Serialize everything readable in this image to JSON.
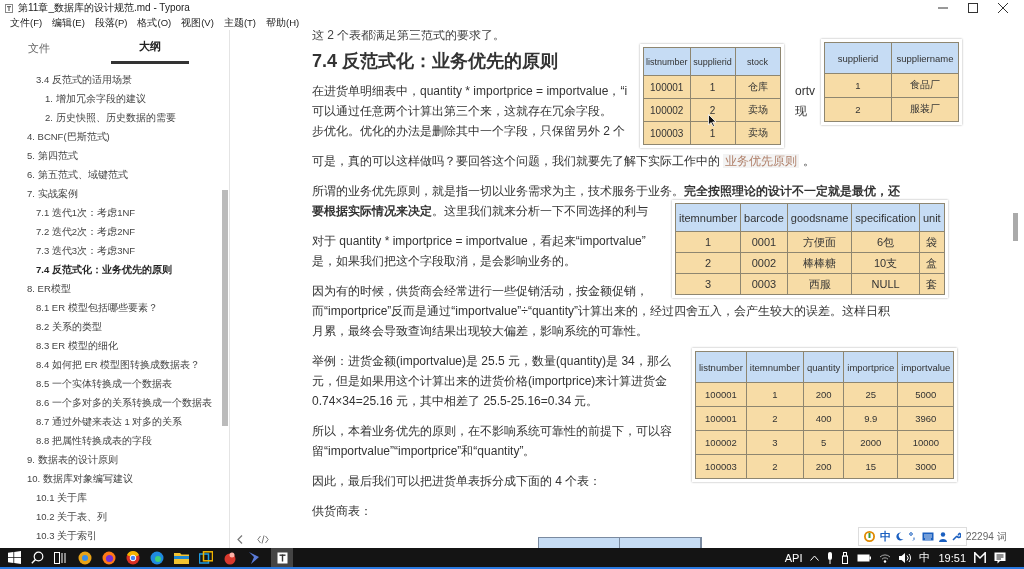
{
  "window": {
    "title": "第11章_数据库的设计规范.md - Typora"
  },
  "menu": [
    "文件(F)",
    "编辑(E)",
    "段落(P)",
    "格式(O)",
    "视图(V)",
    "主题(T)",
    "帮助(H)"
  ],
  "sidebar": {
    "tabs": [
      {
        "label": "文件",
        "selected": false
      },
      {
        "label": "大纲",
        "selected": true
      }
    ],
    "outline_continued": [
      {
        "text": "3.4 反范式的适用场景",
        "selected": false,
        "children": [
          {
            "text": "1. 增加冗余字段的建议",
            "selected": false
          },
          {
            "text": "2. 历史快照、历史数据的需要",
            "selected": false
          }
        ]
      }
    ],
    "outline": [
      {
        "text": "4. BCNF(巴斯范式)",
        "selected": false
      },
      {
        "text": "5. 第四范式",
        "selected": false
      },
      {
        "text": "6. 第五范式、域键范式",
        "selected": false
      },
      {
        "text": "7. 实战案例",
        "selected": false,
        "children": [
          {
            "text": "7.1 迭代1次：考虑1NF",
            "selected": false
          },
          {
            "text": "7.2 迭代2次：考虑2NF",
            "selected": false
          },
          {
            "text": "7.3 迭代3次：考虑3NF",
            "selected": false
          },
          {
            "text": "7.4 反范式化：业务优先的原则",
            "selected": true
          }
        ]
      },
      {
        "text": "8. ER模型",
        "selected": false,
        "children": [
          {
            "text": "8.1 ER 模型包括哪些要素？",
            "selected": false
          },
          {
            "text": "8.2 关系的类型",
            "selected": false
          },
          {
            "text": "8.3 ER 模型的细化",
            "selected": false
          },
          {
            "text": "8.4 如何把 ER 模型图转换成数据表？",
            "selected": false
          },
          {
            "text": "8.5 一个实体转换成一个数据表",
            "selected": false
          },
          {
            "text": "8.6 一个多对多的关系转换成一个数据表",
            "selected": false
          },
          {
            "text": "8.7 通过外键来表达 1 对多的关系",
            "selected": false
          },
          {
            "text": "8.8 把属性转换成表的字段",
            "selected": false
          }
        ]
      },
      {
        "text": "9. 数据表的设计原则",
        "selected": false
      },
      {
        "text": "10. 数据库对象编写建议",
        "selected": false,
        "children": [
          {
            "text": "10.1 关于库",
            "selected": false
          },
          {
            "text": "10.2 关于表、列",
            "selected": false
          },
          {
            "text": "10.3 关于索引",
            "selected": false
          }
        ]
      }
    ]
  },
  "editor": {
    "blocks": [
      {
        "kind": "cut_line",
        "text": "这 2 个表都满足第三范式的要求了。"
      },
      {
        "kind": "heading",
        "text": "7.4 反范式化：业务优先的原则"
      },
      {
        "kind": "paragraph",
        "lines": [
          {
            "text": "在进货单明细表中，quantity * importprice = importvalue，“i",
            "tail": "ortv"
          },
          {
            "text": "可以通过任意两个计算出第三个来，这就存在冗余字段。",
            "tail": "现"
          },
          {
            "text": "步优化。优化的办法是删除其中一个字段，只保留另外 2 个"
          }
        ]
      },
      {
        "kind": "paragraph",
        "lines": [
          {
            "text": "可是，真的可以这样做吗？要回答这个问题，我们就要先了解下实际工作中的 ",
            "link": "业务优先原则",
            "after": " 。"
          }
        ]
      },
      {
        "kind": "paragraph",
        "lines": [
          {
            "text": "所谓的业务优先原则，就是指一切以业务需求为主，技术服务于业务。**完全按照理论的设计不一定就是最优，还**"
          },
          {
            "text": "**要根据实际情况来决定**。这里我们就来分析一下不同选择的利与"
          }
        ]
      },
      {
        "kind": "paragraph",
        "lines": [
          {
            "text": "对于 quantity * importprice = importvalue，看起来“importvalue”"
          },
          {
            "text": "是，如果我们把这个字段取消，是会影响业务的。"
          }
        ]
      },
      {
        "kind": "paragraph",
        "lines": [
          {
            "text": "因为有的时候，供货商会经常进行一些促销活动，按金额促销，"
          },
          {
            "text": "而“importprice”反而是通过“importvalue”÷“quantity”计算出来的，经过四舍五入，会产生较大的误差。这样日积"
          },
          {
            "text": "月累，最终会导致查询结果出现较大偏差，影响系统的可靠性。"
          }
        ]
      },
      {
        "kind": "paragraph",
        "lines": [
          {
            "text": "举例：进货金额(importvalue)是 25.5 元，数量(quantity)是 34，那么"
          },
          {
            "text": "元，但是如果用这个计算出来的进货价格(importprice)来计算进货金"
          },
          {
            "text": "0.74×34=25.16 元，其中相差了 25.5-25.16=0.34 元。"
          }
        ]
      },
      {
        "kind": "paragraph",
        "lines": [
          {
            "text": "所以，本着业务优先的原则，在不影响系统可靠性的前提下，可以容"
          },
          {
            "text": "留“importvalue”“importprice”和“quantity”。"
          }
        ]
      },
      {
        "kind": "paragraph",
        "lines": [
          {
            "text": "因此，最后我们可以把进货单表拆分成下面的 4 个表："
          }
        ]
      },
      {
        "kind": "paragraph",
        "lines": [
          {
            "text": "供货商表："
          }
        ]
      }
    ],
    "floating_tables": [
      {
        "columns": [
          "listnumber",
          "supplierid",
          "stock"
        ],
        "rows": [
          [
            "100001",
            "1",
            "仓库"
          ],
          [
            "100002",
            "2",
            "卖场"
          ],
          [
            "100003",
            "1",
            "卖场"
          ]
        ]
      },
      {
        "columns": [
          "supplierid",
          "suppliername"
        ],
        "rows": [
          [
            "1",
            "食品厂"
          ],
          [
            "2",
            "服装厂"
          ]
        ]
      },
      {
        "columns": [
          "itemnumber",
          "barcode",
          "goodsname",
          "specification",
          "unit"
        ],
        "rows": [
          [
            "1",
            "0001",
            "方便面",
            "6包",
            "袋"
          ],
          [
            "2",
            "0002",
            "棒棒糖",
            "10支",
            "盒"
          ],
          [
            "3",
            "0003",
            "西服",
            "NULL",
            "套"
          ]
        ]
      },
      {
        "columns": [
          "listnumber",
          "itemnumber",
          "quantity",
          "importprice",
          "importvalue"
        ],
        "rows": [
          [
            "100001",
            "1",
            "200",
            "25",
            "5000"
          ],
          [
            "100001",
            "2",
            "400",
            "9.9",
            "3960"
          ],
          [
            "100002",
            "3",
            "5",
            "2000",
            "10000"
          ],
          [
            "100003",
            "2",
            "200",
            "15",
            "3000"
          ]
        ]
      }
    ],
    "word_count": "22294 词"
  },
  "ime": {
    "label": "中"
  },
  "taskbar": {
    "tray_label": "API",
    "input_mode": "中",
    "clock": "19:51"
  }
}
